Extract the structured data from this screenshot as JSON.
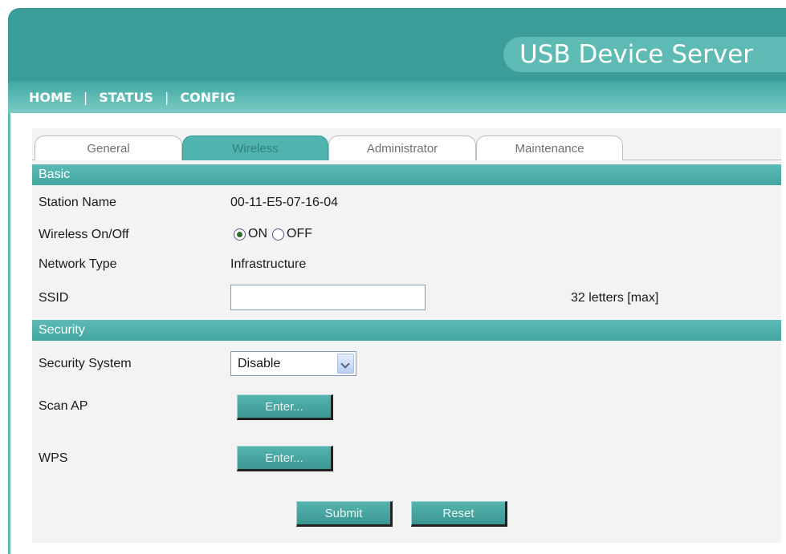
{
  "header": {
    "title": "USB Device Server"
  },
  "nav": {
    "home": "HOME",
    "sep1": "|",
    "status": "STATUS",
    "sep2": "|",
    "config": "CONFIG"
  },
  "tabs": [
    {
      "label": "General",
      "active": false
    },
    {
      "label": "Wireless",
      "active": true
    },
    {
      "label": "Administrator",
      "active": false
    },
    {
      "label": "Maintenance",
      "active": false
    }
  ],
  "sections": {
    "basic": "Basic",
    "security": "Security"
  },
  "basic": {
    "station_name_label": "Station Name",
    "station_name_value": "00-11-E5-07-16-04",
    "wireless_label": "Wireless On/Off",
    "wireless_on": "ON",
    "wireless_off": "OFF",
    "wireless_selected": "ON",
    "network_type_label": "Network Type",
    "network_type_value": "Infrastructure",
    "ssid_label": "SSID",
    "ssid_value": "",
    "ssid_hint": "32 letters [max]"
  },
  "security": {
    "system_label": "Security System",
    "system_value": "Disable",
    "scan_ap_label": "Scan AP",
    "scan_ap_button": "Enter...",
    "wps_label": "WPS",
    "wps_button": "Enter..."
  },
  "actions": {
    "submit": "Submit",
    "reset": "Reset"
  },
  "colors": {
    "accent": "#3a9d98",
    "accent_light": "#5dbbb4",
    "panel": "#f3f3f3"
  }
}
